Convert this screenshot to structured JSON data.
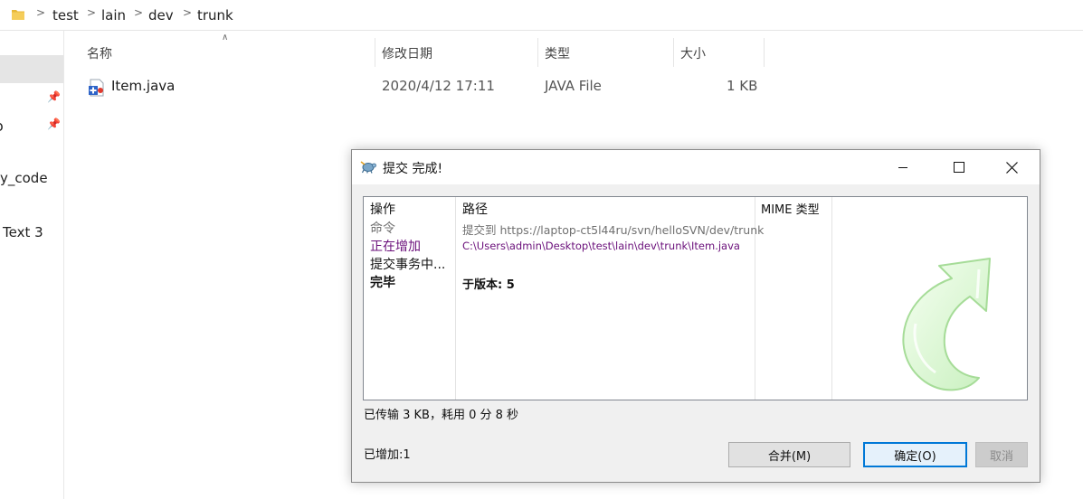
{
  "explorer": {
    "breadcrumb": [
      "test",
      "lain",
      "dev",
      "trunk"
    ],
    "sidebar": {
      "items": [
        {
          "label": "y_code"
        },
        {
          "label": "Text 3"
        }
      ]
    },
    "columns": {
      "name": "名称",
      "modified": "修改日期",
      "type": "类型",
      "size": "大小"
    },
    "files": [
      {
        "name": "Item.java",
        "modified": "2020/4/12 17:11",
        "type": "JAVA File",
        "size": "1 KB"
      }
    ]
  },
  "dialog": {
    "title": "提交 完成!",
    "list": {
      "headers": {
        "action": "操作",
        "path": "路径",
        "mime": "MIME 类型"
      },
      "rows": [
        {
          "action": "命令",
          "path": "提交到 https://laptop-ct5l44ru/svn/helloSVN/dev/trunk",
          "style": "gray"
        },
        {
          "action": "正在增加",
          "path": "C:\\Users\\admin\\Desktop\\test\\lain\\dev\\trunk\\Item.java",
          "style": "purple"
        },
        {
          "action": "提交事务中...",
          "path": "",
          "style": "normal"
        },
        {
          "action": "完毕",
          "path": "于版本: 5",
          "style": "bold"
        }
      ]
    },
    "status": "已传输 3 KB，耗用 0 分 8 秒",
    "added": "已增加:1",
    "buttons": {
      "merge": "合并(M)",
      "ok": "确定(O)",
      "cancel": "取消"
    },
    "colors": {
      "purple": "#6a0f7a",
      "gray": "#707070",
      "accent": "#0078d7"
    }
  }
}
